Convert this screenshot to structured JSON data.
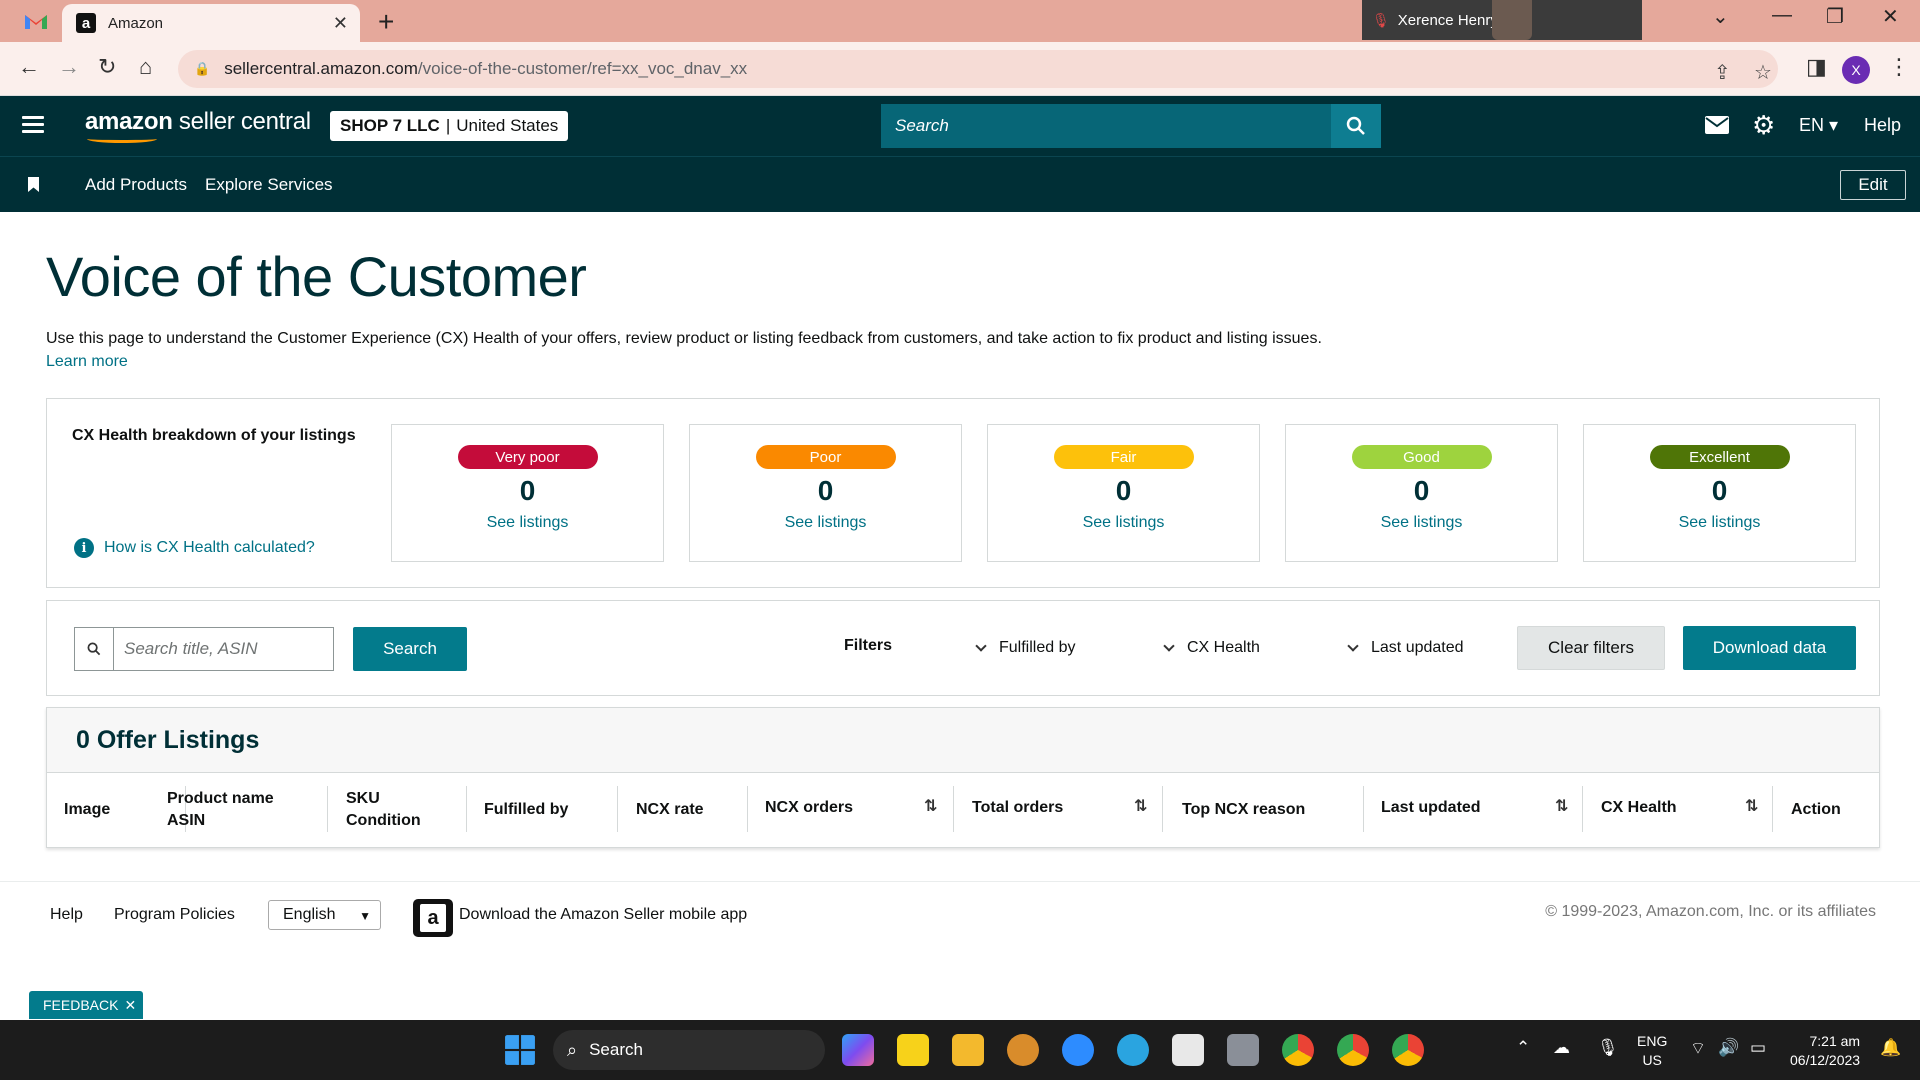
{
  "browser": {
    "tab_title": "Amazon",
    "tab_favicon": "a",
    "video_call_name": "Xerence Henry",
    "url_host": "sellercentral.amazon.com",
    "url_path": "/voice-of-the-customer/ref=xx_voc_dnav_xx",
    "profile_initial": "X"
  },
  "header": {
    "logo_bold": "amazon",
    "logo_rest": " seller central",
    "shop_name": "SHOP 7 LLC",
    "shop_region": "United States",
    "search_placeholder": "Search",
    "language": "EN",
    "help": "Help"
  },
  "subnav": {
    "items": [
      "Add Products",
      "Explore Services"
    ],
    "edit": "Edit"
  },
  "page": {
    "title": "Voice of the Customer",
    "intro": "Use this page to understand the Customer Experience (CX) Health of your offers, review product or listing feedback from customers, and take action to fix product and listing issues.",
    "learn_more": "Learn more"
  },
  "health": {
    "title": "CX Health breakdown of your listings",
    "help_link": "How is CX Health calculated?",
    "tiles": [
      {
        "label": "Very poor",
        "count": "0",
        "link": "See listings",
        "color": "#c40c3a"
      },
      {
        "label": "Poor",
        "count": "0",
        "link": "See listings",
        "color": "#fa8900"
      },
      {
        "label": "Fair",
        "count": "0",
        "link": "See listings",
        "color": "#fdc10b"
      },
      {
        "label": "Good",
        "count": "0",
        "link": "See listings",
        "color": "#9ed33e"
      },
      {
        "label": "Excellent",
        "count": "0",
        "link": "See listings",
        "color": "#4f7507"
      }
    ]
  },
  "filters": {
    "search_placeholder": "Search title, ASIN",
    "search_button": "Search",
    "label": "Filters",
    "dropdowns": [
      "Fulfilled by",
      "CX Health",
      "Last updated"
    ],
    "clear": "Clear filters",
    "download": "Download data"
  },
  "table": {
    "count_title": "0 Offer Listings",
    "columns": {
      "image": "Image",
      "product_name": "Product name",
      "asin": "ASIN",
      "sku": "SKU",
      "condition": "Condition",
      "fulfilled_by": "Fulfilled by",
      "ncx_rate": "NCX rate",
      "ncx_orders": "NCX orders",
      "total_orders": "Total orders",
      "top_reason": "Top NCX reason",
      "last_updated": "Last updated",
      "cx_health": "CX Health",
      "action": "Action"
    }
  },
  "footer": {
    "help": "Help",
    "policies": "Program Policies",
    "language": "English",
    "app_text": "Download the Amazon Seller mobile app",
    "copyright": "© 1999-2023, Amazon.com, Inc. or its affiliates",
    "feedback": "FEEDBACK"
  },
  "taskbar": {
    "search": "Search",
    "lang_top": "ENG",
    "lang_bottom": "US",
    "time": "7:21 am",
    "date": "06/12/2023"
  }
}
